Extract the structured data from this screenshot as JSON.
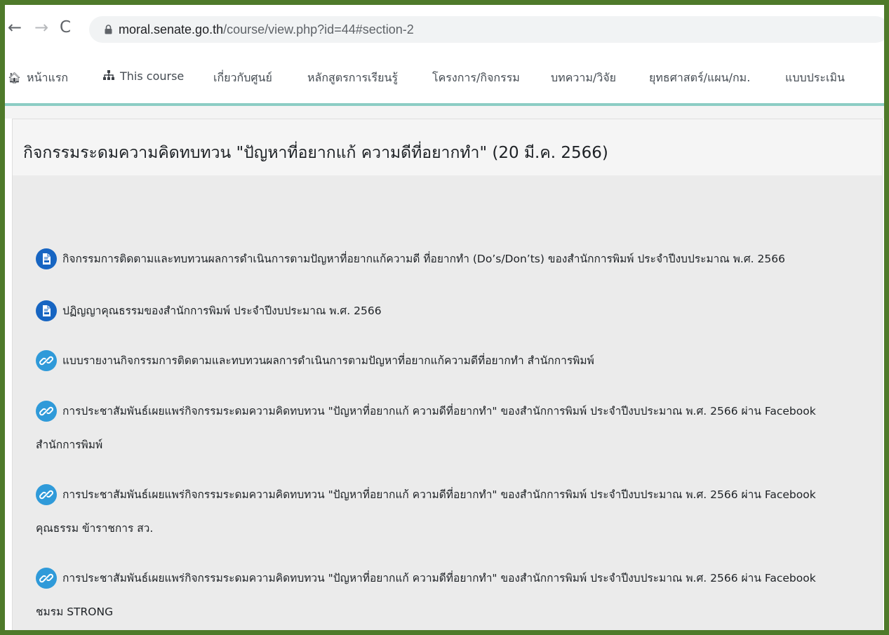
{
  "browser": {
    "url_host": "moral.senate.go.th",
    "url_path": "/course/view.php?id=44#section-2"
  },
  "menu": {
    "items": [
      {
        "label": "หน้าแรก",
        "icon": "home-icon"
      },
      {
        "label": "This course",
        "icon": "sitemap-icon"
      },
      {
        "label": "เกี่ยวกับศูนย์"
      },
      {
        "label": "หลักสูตรการเรียนรู้"
      },
      {
        "label": "โครงการ/กิจกรรม"
      },
      {
        "label": "บทความ/วิจัย"
      },
      {
        "label": "ยุทธศาสตร์/แผน/กม."
      },
      {
        "label": "แบบประเมิน"
      }
    ]
  },
  "section": {
    "title": "กิจกรรมระดมความคิดทบทวน \"ปัญหาที่อยากแก้ ความดีที่อยากทำ\" (20 มี.ค. 2566)",
    "activities": [
      {
        "type": "file",
        "icon": "pdf-file-icon",
        "text": "กิจกรรมการติดตามและทบทวนผลการดำเนินการตามปัญหาที่อยากแก้ความดี ที่อยากทำ (Do’s/Don’ts) ของสำนักการพิมพ์ ประจำปีงบประมาณ พ.ศ. 2566",
        "cont": ""
      },
      {
        "type": "file",
        "icon": "pdf-file-icon",
        "text": "ปฏิญญาคุณธรรมของสำนักการพิมพ์ ประจำปีงบประมาณ พ.ศ. 2566",
        "cont": ""
      },
      {
        "type": "url",
        "icon": "link-icon",
        "text": "แบบรายงานกิจกรรมการติดตามและทบทวนผลการดำเนินการตามปัญหาที่อยากแก้ความดีที่อยากทำ สำนักการพิมพ์",
        "cont": ""
      },
      {
        "type": "url",
        "icon": "link-icon",
        "text": "การประชาสัมพันธ์เผยแพร่กิจกรรมระดมความคิดทบทวน \"ปัญหาที่อยากแก้ ความดีที่อยากทำ\" ของสำนักการพิมพ์ ประจำปีงบประมาณ พ.ศ. 2566 ผ่าน Facebook",
        "cont": "สำนักการพิมพ์"
      },
      {
        "type": "url",
        "icon": "link-icon",
        "text": "การประชาสัมพันธ์เผยแพร่กิจกรรมระดมความคิดทบทวน \"ปัญหาที่อยากแก้ ความดีที่อยากทำ\" ของสำนักการพิมพ์ ประจำปีงบประมาณ พ.ศ. 2566 ผ่าน Facebook",
        "cont": "คุณธรรม ข้าราชการ สว."
      },
      {
        "type": "url",
        "icon": "link-icon",
        "text": "การประชาสัมพันธ์เผยแพร่กิจกรรมระดมความคิดทบทวน \"ปัญหาที่อยากแก้ ความดีที่อยากทำ\" ของสำนักการพิมพ์ ประจำปีงบประมาณ พ.ศ. 2566 ผ่าน Facebook",
        "cont": "ชมรม STRONG"
      }
    ]
  },
  "colors": {
    "frame_border": "#4f7a2a",
    "menu_rule": "#8ccdc4",
    "file_icon": "#1765c2",
    "url_icon": "#2f9ad9"
  }
}
